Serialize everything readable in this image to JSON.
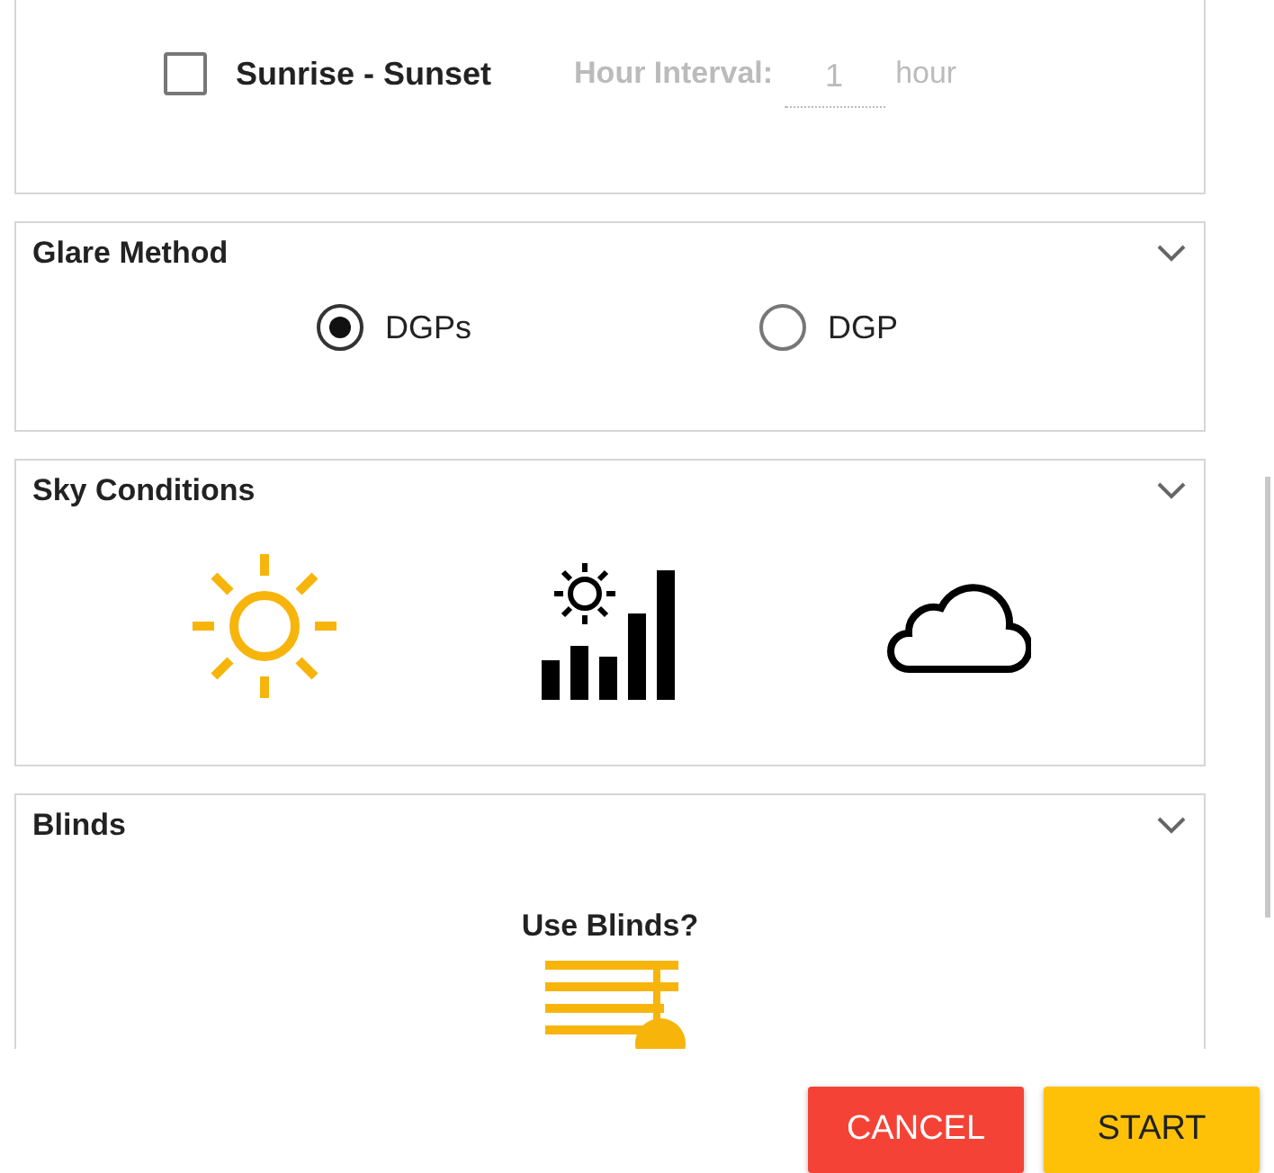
{
  "time_range": {
    "sunrise_sunset": {
      "label": "Sunrise - Sunset",
      "checked": false
    },
    "interval": {
      "label": "Hour Interval:",
      "value": "1",
      "unit": "hour",
      "disabled": true
    }
  },
  "glare_method": {
    "title": "Glare Method",
    "expanded": true,
    "options": [
      {
        "label": "DGPs",
        "selected": true
      },
      {
        "label": "DGP",
        "selected": false
      }
    ]
  },
  "sky_conditions": {
    "title": "Sky Conditions",
    "expanded": true,
    "options": [
      {
        "kind": "sunny",
        "selected": true
      },
      {
        "kind": "intermediate",
        "selected": false
      },
      {
        "kind": "overcast",
        "selected": false
      }
    ]
  },
  "blinds": {
    "title": "Blinds",
    "expanded": true,
    "question": "Use Blinds?",
    "on": true
  },
  "buttons": [
    {
      "kind": "cancel",
      "label": "CANCEL"
    },
    {
      "kind": "start",
      "label": "START"
    }
  ]
}
